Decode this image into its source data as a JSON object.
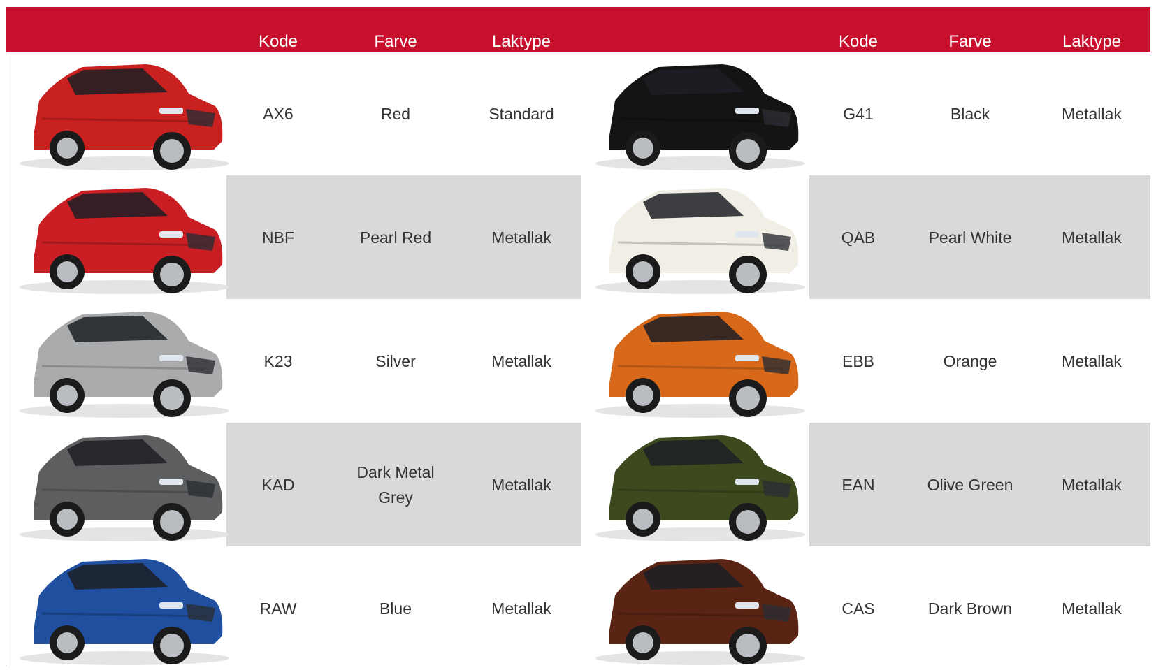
{
  "headers": {
    "left": {
      "code": "Kode",
      "color": "Farve",
      "paint": "Laktype"
    },
    "right": {
      "code": "Kode",
      "color": "Farve",
      "paint": "Laktype"
    }
  },
  "rows": [
    {
      "left": {
        "code": "AX6",
        "color": "Red",
        "paint": "Standard",
        "car_color": "#c8211f"
      },
      "right": {
        "code": "G41",
        "color": "Black",
        "paint": "Metallak",
        "car_color": "#141414"
      }
    },
    {
      "left": {
        "code": "NBF",
        "color": "Pearl Red",
        "paint": "Metallak",
        "car_color": "#c81e24"
      },
      "right": {
        "code": "QAB",
        "color": "Pearl White",
        "paint": "Metallak",
        "car_color": "#f1eee6"
      }
    },
    {
      "left": {
        "code": "K23",
        "color": "Silver",
        "paint": "Metallak",
        "car_color": "#a9abac"
      },
      "right": {
        "code": "EBB",
        "color": "Orange",
        "paint": "Metallak",
        "car_color": "#d9691a"
      }
    },
    {
      "left": {
        "code": "KAD",
        "color": "Dark Metal\nGrey",
        "paint": "Metallak",
        "car_color": "#5d5e60"
      },
      "right": {
        "code": "EAN",
        "color": "Olive Green",
        "paint": "Metallak",
        "car_color": "#3c4a1e"
      }
    },
    {
      "left": {
        "code": "RAW",
        "color": "Blue",
        "paint": "Metallak",
        "car_color": "#1f4f9e"
      },
      "right": {
        "code": "CAS",
        "color": "Dark Brown",
        "paint": "Metallak",
        "car_color": "#5a2414"
      }
    }
  ],
  "colors": {
    "header": "#c8102e",
    "row_alt": "#d9d9d9",
    "text": "#333333",
    "header_text": "#ffffff"
  }
}
